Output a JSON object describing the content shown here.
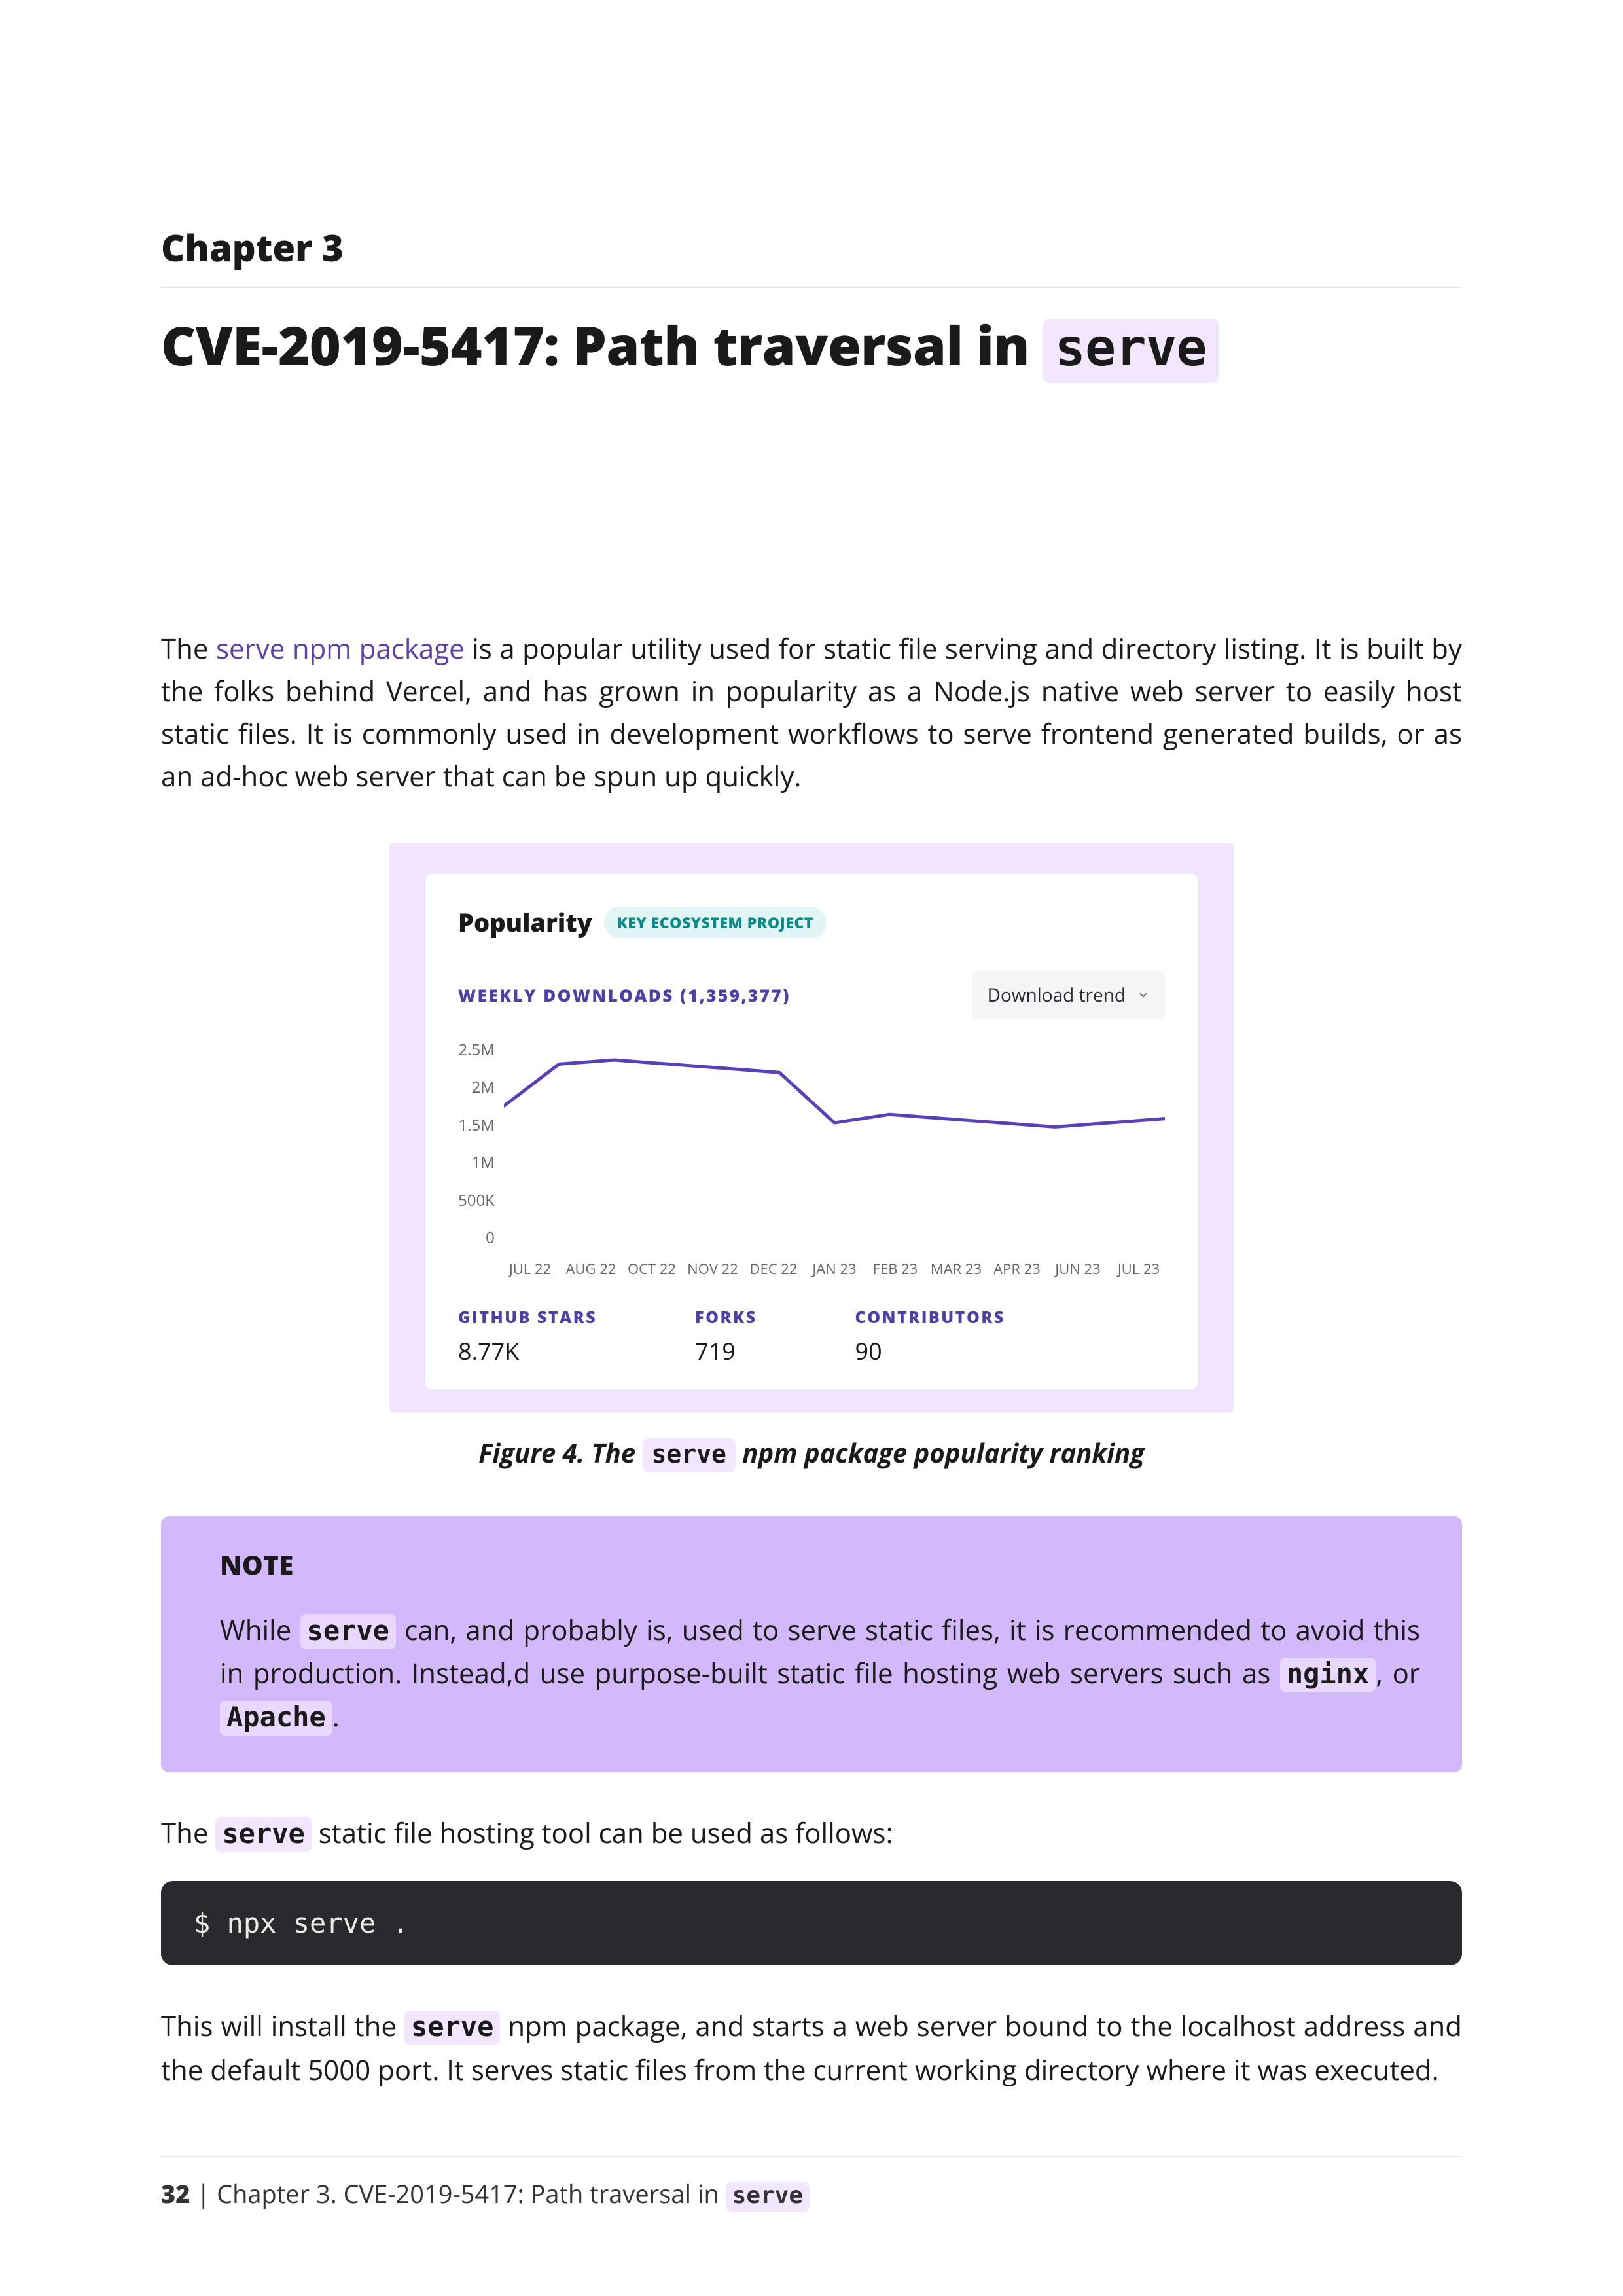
{
  "chapter_label": "Chapter 3",
  "title_prefix": "CVE-2019-5417: Path traversal in ",
  "title_code": "serve",
  "intro": {
    "p1_a": "The ",
    "link_text": "serve npm package",
    "p1_b": " is a popular utility used for static file serving and directory listing. It is built by the folks behind Vercel, and has grown in popularity as a Node.js native web server to easily host static files. It is commonly used in development workflows to serve frontend generated builds, or as an ad-hoc web server that can be spun up quickly."
  },
  "figure": {
    "popularity_title": "Popularity",
    "badge": "KEY ECOSYSTEM PROJECT",
    "weekly_downloads_label": "WEEKLY DOWNLOADS (1,359,377)",
    "dropdown": "Download trend",
    "stats": {
      "stars_label": "GITHUB STARS",
      "stars_value": "8.77K",
      "forks_label": "FORKS",
      "forks_value": "719",
      "contrib_label": "CONTRIBUTORS",
      "contrib_value": "90"
    },
    "caption_a": "Figure 4. The ",
    "caption_code": "serve",
    "caption_b": " npm package popularity ranking"
  },
  "chart_data": {
    "type": "line",
    "title": "Weekly downloads trend",
    "xlabel": "",
    "ylabel": "",
    "categories": [
      "JUL 22",
      "AUG 22",
      "OCT 22",
      "NOV 22",
      "DEC 22",
      "JAN 23",
      "FEB 23",
      "MAR 23",
      "APR 23",
      "JUN 23",
      "JUL 23"
    ],
    "y_ticks": [
      "2.5M",
      "2M",
      "1.5M",
      "1M",
      "500K",
      "0"
    ],
    "ylim": [
      0,
      2500000
    ],
    "series": [
      {
        "name": "Weekly downloads",
        "values": [
          1700000,
          2200000,
          2250000,
          2200000,
          2150000,
          2100000,
          1500000,
          1600000,
          1550000,
          1500000,
          1450000,
          1500000,
          1550000
        ]
      }
    ]
  },
  "note": {
    "title": "NOTE",
    "p_a": "While ",
    "code1": "serve",
    "p_b": " can, and probably is, used to serve static files, it is recommended to avoid this in production. Instead,d use purpose-built static file hosting web servers such as ",
    "code2": "nginx",
    "p_c": ", or ",
    "code3": "Apache",
    "p_d": "."
  },
  "usage_intro_a": "The ",
  "usage_intro_code": "serve",
  "usage_intro_b": " static file hosting tool can be used as follows:",
  "code_block": "$ npx serve .",
  "after_code_a": "This will install the ",
  "after_code_code": "serve",
  "after_code_b": " npm package, and starts a web server bound to the localhost address and the default 5000 port. It serves static files from the current working directory where it was executed.",
  "footer": {
    "page": "32",
    "sep": " | ",
    "text_a": "Chapter 3. CVE-2019-5417: Path traversal in ",
    "code": "serve"
  }
}
